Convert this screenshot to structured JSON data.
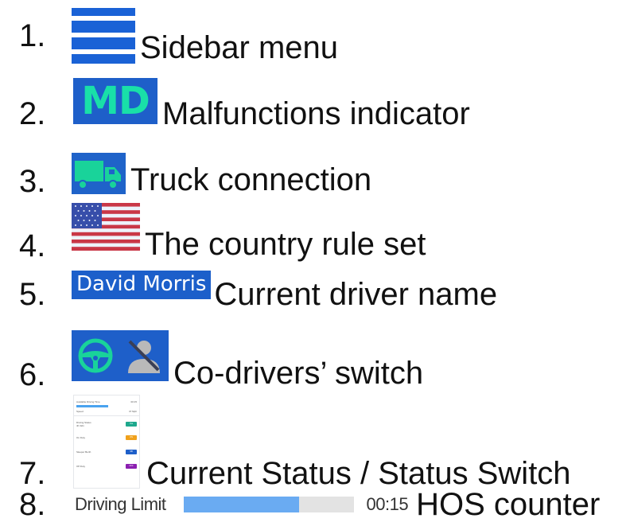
{
  "items": [
    {
      "num": "1.",
      "label": "Sidebar menu",
      "icon": "hamburger-menu-icon"
    },
    {
      "num": "2.",
      "label": "Malfunctions indicator",
      "badge": "MD",
      "badge_color": "#19e0a8",
      "bg": "#1e5fc9"
    },
    {
      "num": "3.",
      "label": "Truck connection",
      "icon": "truck-icon"
    },
    {
      "num": "4.",
      "label": "The country rule set",
      "icon": "us-flag-icon"
    },
    {
      "num": "5.",
      "label": "Current driver name",
      "driver_name": "David Morris"
    },
    {
      "num": "6.",
      "label": "Co-drivers’ switch",
      "icons": [
        "steering-wheel-icon",
        "person-disabled-icon"
      ]
    },
    {
      "num": "7.",
      "label": "Current Status / Status Switch",
      "thumbnail": {
        "available_driving_time_label": "Available Driving Time",
        "available_driving_time_value": "00:15",
        "speed_label": "Speed",
        "speed_value": "37 Mph",
        "statuses": [
          {
            "label": "Driving Status",
            "sub": "4h 32m",
            "pill": "Yes",
            "color": "#1ea88d"
          },
          {
            "label": "On Duty",
            "sub": "",
            "pill": "ON",
            "color": "#f0a11c"
          },
          {
            "label": "Sleeper Berth",
            "sub": "",
            "pill": "SB",
            "color": "#1e5fc9"
          },
          {
            "label": "Off Duty",
            "sub": "",
            "pill": "OFF",
            "color": "#8b1fb0"
          }
        ]
      }
    },
    {
      "num": "8.",
      "label": "HOS counter",
      "hos_label": "Driving Limit",
      "hos_time": "00:15",
      "hos_fill": 0.68
    }
  ]
}
